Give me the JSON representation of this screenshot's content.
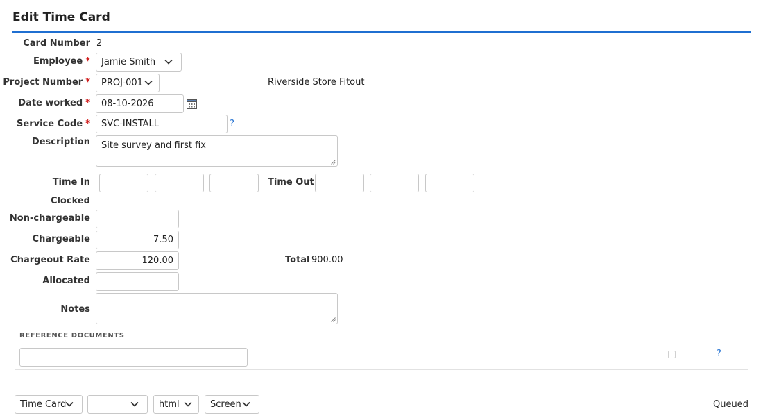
{
  "page": {
    "title": "Edit Time Card"
  },
  "form": {
    "card_number": {
      "label": "Card Number",
      "value": "2"
    },
    "employee": {
      "label": "Employee",
      "required": "*",
      "value": "Jamie Smith"
    },
    "project_number": {
      "label": "Project Number",
      "required": "*",
      "value": "PROJ-001",
      "project_name": "Riverside Store Fitout"
    },
    "date_worked": {
      "label": "Date worked",
      "required": "*",
      "value": "08-10-2026"
    },
    "service_code": {
      "label": "Service Code",
      "required": "*",
      "value": "SVC-INSTALL",
      "help": "?"
    },
    "description": {
      "label": "Description",
      "value": "Site survey and first fix"
    },
    "time_in": {
      "label": "Time In",
      "fields": [
        "",
        "",
        ""
      ]
    },
    "time_out": {
      "label": "Time Out",
      "fields": [
        "",
        "",
        ""
      ]
    },
    "clocked": {
      "label": "Clocked"
    },
    "non_chargeable": {
      "label": "Non-chargeable",
      "value": ""
    },
    "chargeable": {
      "label": "Chargeable",
      "value": "7.50"
    },
    "chargeout_rate": {
      "label": "Chargeout Rate",
      "value": "120.00"
    },
    "total": {
      "label": "Total",
      "value": "900.00"
    },
    "allocated": {
      "label": "Allocated",
      "value": ""
    },
    "notes": {
      "label": "Notes",
      "value": ""
    }
  },
  "reference_documents": {
    "label": "REFERENCE DOCUMENTS",
    "value": "",
    "help": "?"
  },
  "footer": {
    "template_select": "Time Card",
    "blank_select": "",
    "format_select": "html",
    "media_select": "Screen",
    "status": "Queued"
  },
  "colors": {
    "accent": "#1f6fd1",
    "required": "#d11b1b"
  },
  "icons": {
    "calendar": "calendar-icon",
    "chevron": "chevron-down-icon",
    "resize": "resize-grip-icon"
  }
}
